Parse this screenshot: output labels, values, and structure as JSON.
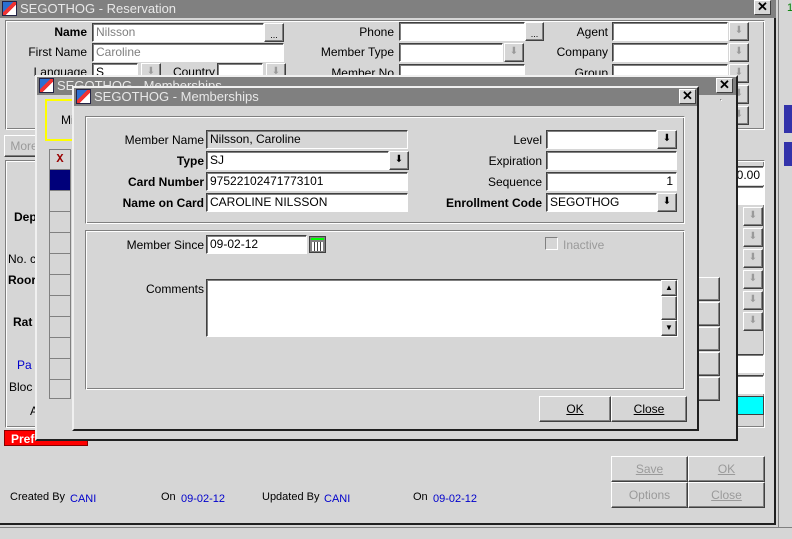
{
  "reservation_window": {
    "title": "SEGOTHOG - Reservation",
    "fields": {
      "name_label": "Name",
      "name_value": "Nilsson",
      "first_name_label": "First Name",
      "first_name_value": "Caroline",
      "language_label": "Language",
      "language_value": "S",
      "country_label": "Country",
      "country_value": "",
      "phone_label": "Phone",
      "phone_value": "",
      "member_type_label": "Member Type",
      "member_type_value": "",
      "member_no_label": "Member No",
      "member_no_value": "",
      "agent_label": "Agent",
      "agent_value": "",
      "company_label": "Company",
      "company_value": "",
      "group_label": "Group",
      "group_value": ""
    },
    "more_button": "More",
    "left_labels": [
      "Dep",
      "No. c",
      "Roor",
      "Rat",
      "Pa",
      "Bloc",
      "A"
    ],
    "amount_value": "0.00",
    "preferences_badge": "Pref",
    "footer": {
      "created_by_label": "Created By",
      "created_by_value": "CANI",
      "created_on_label": "On",
      "created_on_value": "09-02-12",
      "updated_by_label": "Updated By",
      "updated_by_value": "CANI",
      "updated_on_label": "On",
      "updated_on_value": "09-02-12"
    },
    "buttons": {
      "save": "Save",
      "ok": "OK",
      "options": "Options",
      "close": "Close"
    },
    "side_indicator": "1"
  },
  "memberships_list_window": {
    "title": "SEGOTHOG - Memberships",
    "partial_label": "Mi",
    "delete_column_icon": "X"
  },
  "memberships_dialog": {
    "title": "SEGOTHOG - Memberships",
    "member_name_label": "Member Name",
    "member_name_value": "Nilsson, Caroline",
    "type_label": "Type",
    "type_value": "SJ",
    "card_number_label": "Card Number",
    "card_number_value": "975221024717731​01",
    "name_on_card_label": "Name on Card",
    "name_on_card_value": "CAROLINE NILSSON",
    "level_label": "Level",
    "level_value": "",
    "expiration_label": "Expiration",
    "expiration_value": "",
    "sequence_label": "Sequence",
    "sequence_value": "1",
    "enrollment_code_label": "Enrollment Code",
    "enrollment_code_value": "SEGOTHOG",
    "member_since_label": "Member Since",
    "member_since_value": "09-02-12",
    "inactive_label": "Inactive",
    "inactive_checked": false,
    "comments_label": "Comments",
    "comments_value": "",
    "ok_button": "OK",
    "close_button": "Close"
  }
}
